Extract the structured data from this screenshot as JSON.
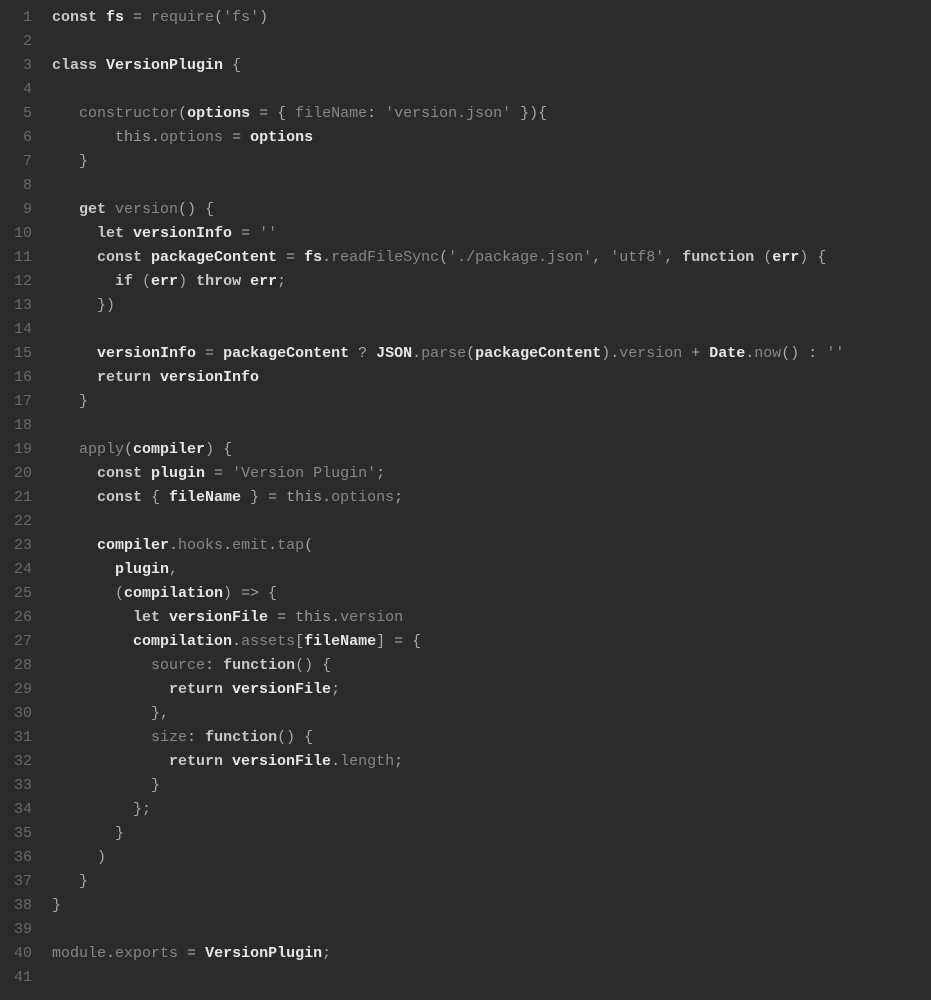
{
  "editor": {
    "language": "javascript",
    "line_count": 41,
    "line_numbers": [
      "1",
      "2",
      "3",
      "4",
      "5",
      "6",
      "7",
      "8",
      "9",
      "10",
      "11",
      "12",
      "13",
      "14",
      "15",
      "16",
      "17",
      "18",
      "19",
      "20",
      "21",
      "22",
      "23",
      "24",
      "25",
      "26",
      "27",
      "28",
      "29",
      "30",
      "31",
      "32",
      "33",
      "34",
      "35",
      "36",
      "37",
      "38",
      "39",
      "40",
      "41"
    ],
    "lines": [
      {
        "n": 1,
        "raw": "const fs = require('fs')",
        "tokens": [
          {
            "t": "const ",
            "c": "kw"
          },
          {
            "t": "fs ",
            "c": "name"
          },
          {
            "t": "= ",
            "c": "pun"
          },
          {
            "t": "require",
            "c": "dim"
          },
          {
            "t": "(",
            "c": "pun"
          },
          {
            "t": "'fs'",
            "c": "str"
          },
          {
            "t": ")",
            "c": "pun"
          }
        ]
      },
      {
        "n": 2,
        "raw": "",
        "tokens": []
      },
      {
        "n": 3,
        "raw": "class VersionPlugin {",
        "tokens": [
          {
            "t": "class ",
            "c": "kw"
          },
          {
            "t": "VersionPlugin ",
            "c": "name"
          },
          {
            "t": "{",
            "c": "pun"
          }
        ]
      },
      {
        "n": 4,
        "raw": "",
        "tokens": []
      },
      {
        "n": 5,
        "raw": "   constructor(options = { fileName: 'version.json' }){",
        "tokens": [
          {
            "t": "   ",
            "c": ""
          },
          {
            "t": "constructor",
            "c": "dim"
          },
          {
            "t": "(",
            "c": "pun"
          },
          {
            "t": "options ",
            "c": "name"
          },
          {
            "t": "= { ",
            "c": "pun"
          },
          {
            "t": "fileName",
            "c": "dim"
          },
          {
            "t": ": ",
            "c": "pun"
          },
          {
            "t": "'version.json'",
            "c": "str"
          },
          {
            "t": " }){",
            "c": "pun"
          }
        ]
      },
      {
        "n": 6,
        "raw": "       this.options = options",
        "tokens": [
          {
            "t": "       ",
            "c": ""
          },
          {
            "t": "this",
            "c": "this"
          },
          {
            "t": ".",
            "c": "pun"
          },
          {
            "t": "options ",
            "c": "dim"
          },
          {
            "t": "= ",
            "c": "pun"
          },
          {
            "t": "options",
            "c": "name"
          }
        ]
      },
      {
        "n": 7,
        "raw": "   }",
        "tokens": [
          {
            "t": "   }",
            "c": "pun"
          }
        ]
      },
      {
        "n": 8,
        "raw": "",
        "tokens": []
      },
      {
        "n": 9,
        "raw": "   get version() {",
        "tokens": [
          {
            "t": "   ",
            "c": ""
          },
          {
            "t": "get ",
            "c": "kw"
          },
          {
            "t": "version",
            "c": "dim"
          },
          {
            "t": "() {",
            "c": "pun"
          }
        ]
      },
      {
        "n": 10,
        "raw": "     let versionInfo = ''",
        "tokens": [
          {
            "t": "     ",
            "c": ""
          },
          {
            "t": "let ",
            "c": "kw"
          },
          {
            "t": "versionInfo ",
            "c": "name"
          },
          {
            "t": "= ",
            "c": "pun"
          },
          {
            "t": "''",
            "c": "str"
          }
        ]
      },
      {
        "n": 11,
        "raw": "     const packageContent = fs.readFileSync('./package.json', 'utf8', function (err) {",
        "tokens": [
          {
            "t": "     ",
            "c": ""
          },
          {
            "t": "const ",
            "c": "kw"
          },
          {
            "t": "packageContent ",
            "c": "name"
          },
          {
            "t": "= ",
            "c": "pun"
          },
          {
            "t": "fs",
            "c": "name"
          },
          {
            "t": ".",
            "c": "pun"
          },
          {
            "t": "readFileSync",
            "c": "dim"
          },
          {
            "t": "(",
            "c": "pun"
          },
          {
            "t": "'./package.json'",
            "c": "str"
          },
          {
            "t": ", ",
            "c": "pun"
          },
          {
            "t": "'utf8'",
            "c": "str"
          },
          {
            "t": ", ",
            "c": "pun"
          },
          {
            "t": "function ",
            "c": "kw"
          },
          {
            "t": "(",
            "c": "pun"
          },
          {
            "t": "err",
            "c": "name"
          },
          {
            "t": ") {",
            "c": "pun"
          }
        ]
      },
      {
        "n": 12,
        "raw": "       if (err) throw err;",
        "tokens": [
          {
            "t": "       ",
            "c": ""
          },
          {
            "t": "if ",
            "c": "kw"
          },
          {
            "t": "(",
            "c": "pun"
          },
          {
            "t": "err",
            "c": "name"
          },
          {
            "t": ") ",
            "c": "pun"
          },
          {
            "t": "throw ",
            "c": "kw"
          },
          {
            "t": "err",
            "c": "name"
          },
          {
            "t": ";",
            "c": "pun"
          }
        ]
      },
      {
        "n": 13,
        "raw": "     })",
        "tokens": [
          {
            "t": "     })",
            "c": "pun"
          }
        ]
      },
      {
        "n": 14,
        "raw": "",
        "tokens": []
      },
      {
        "n": 15,
        "raw": "     versionInfo = packageContent ? JSON.parse(packageContent).version + Date.now() : ''",
        "tokens": [
          {
            "t": "     ",
            "c": ""
          },
          {
            "t": "versionInfo ",
            "c": "name"
          },
          {
            "t": "= ",
            "c": "pun"
          },
          {
            "t": "packageContent ",
            "c": "name"
          },
          {
            "t": "? ",
            "c": "pun"
          },
          {
            "t": "JSON",
            "c": "name"
          },
          {
            "t": ".",
            "c": "pun"
          },
          {
            "t": "parse",
            "c": "dim"
          },
          {
            "t": "(",
            "c": "pun"
          },
          {
            "t": "packageContent",
            "c": "name"
          },
          {
            "t": ").",
            "c": "pun"
          },
          {
            "t": "version ",
            "c": "dim"
          },
          {
            "t": "+ ",
            "c": "pun"
          },
          {
            "t": "Date",
            "c": "name"
          },
          {
            "t": ".",
            "c": "pun"
          },
          {
            "t": "now",
            "c": "dim"
          },
          {
            "t": "() : ",
            "c": "pun"
          },
          {
            "t": "''",
            "c": "str"
          }
        ]
      },
      {
        "n": 16,
        "raw": "     return versionInfo",
        "tokens": [
          {
            "t": "     ",
            "c": ""
          },
          {
            "t": "return ",
            "c": "kw"
          },
          {
            "t": "versionInfo",
            "c": "name"
          }
        ]
      },
      {
        "n": 17,
        "raw": "   }",
        "tokens": [
          {
            "t": "   }",
            "c": "pun"
          }
        ]
      },
      {
        "n": 18,
        "raw": "",
        "tokens": []
      },
      {
        "n": 19,
        "raw": "   apply(compiler) {",
        "tokens": [
          {
            "t": "   ",
            "c": ""
          },
          {
            "t": "apply",
            "c": "dim"
          },
          {
            "t": "(",
            "c": "pun"
          },
          {
            "t": "compiler",
            "c": "name"
          },
          {
            "t": ") {",
            "c": "pun"
          }
        ]
      },
      {
        "n": 20,
        "raw": "     const plugin = 'Version Plugin';",
        "tokens": [
          {
            "t": "     ",
            "c": ""
          },
          {
            "t": "const ",
            "c": "kw"
          },
          {
            "t": "plugin ",
            "c": "name"
          },
          {
            "t": "= ",
            "c": "pun"
          },
          {
            "t": "'Version Plugin'",
            "c": "str"
          },
          {
            "t": ";",
            "c": "pun"
          }
        ]
      },
      {
        "n": 21,
        "raw": "     const { fileName } = this.options;",
        "tokens": [
          {
            "t": "     ",
            "c": ""
          },
          {
            "t": "const ",
            "c": "kw"
          },
          {
            "t": "{ ",
            "c": "pun"
          },
          {
            "t": "fileName ",
            "c": "name"
          },
          {
            "t": "} = ",
            "c": "pun"
          },
          {
            "t": "this",
            "c": "this"
          },
          {
            "t": ".",
            "c": "pun"
          },
          {
            "t": "options",
            "c": "dim"
          },
          {
            "t": ";",
            "c": "pun"
          }
        ]
      },
      {
        "n": 22,
        "raw": "",
        "tokens": []
      },
      {
        "n": 23,
        "raw": "     compiler.hooks.emit.tap(",
        "tokens": [
          {
            "t": "     ",
            "c": ""
          },
          {
            "t": "compiler",
            "c": "name"
          },
          {
            "t": ".",
            "c": "pun"
          },
          {
            "t": "hooks",
            "c": "dim"
          },
          {
            "t": ".",
            "c": "pun"
          },
          {
            "t": "emit",
            "c": "dim"
          },
          {
            "t": ".",
            "c": "pun"
          },
          {
            "t": "tap",
            "c": "dim"
          },
          {
            "t": "(",
            "c": "pun"
          }
        ]
      },
      {
        "n": 24,
        "raw": "       plugin,",
        "tokens": [
          {
            "t": "       ",
            "c": ""
          },
          {
            "t": "plugin",
            "c": "name"
          },
          {
            "t": ",",
            "c": "pun"
          }
        ]
      },
      {
        "n": 25,
        "raw": "       (compilation) => {",
        "tokens": [
          {
            "t": "       (",
            "c": "pun"
          },
          {
            "t": "compilation",
            "c": "name"
          },
          {
            "t": ") => {",
            "c": "pun"
          }
        ]
      },
      {
        "n": 26,
        "raw": "         let versionFile = this.version",
        "tokens": [
          {
            "t": "         ",
            "c": ""
          },
          {
            "t": "let ",
            "c": "kw"
          },
          {
            "t": "versionFile ",
            "c": "name"
          },
          {
            "t": "= ",
            "c": "pun"
          },
          {
            "t": "this",
            "c": "this"
          },
          {
            "t": ".",
            "c": "pun"
          },
          {
            "t": "version",
            "c": "dim"
          }
        ]
      },
      {
        "n": 27,
        "raw": "         compilation.assets[fileName] = {",
        "tokens": [
          {
            "t": "         ",
            "c": ""
          },
          {
            "t": "compilation",
            "c": "name"
          },
          {
            "t": ".",
            "c": "pun"
          },
          {
            "t": "assets",
            "c": "dim"
          },
          {
            "t": "[",
            "c": "pun"
          },
          {
            "t": "fileName",
            "c": "name"
          },
          {
            "t": "] = {",
            "c": "pun"
          }
        ]
      },
      {
        "n": 28,
        "raw": "           source: function() {",
        "tokens": [
          {
            "t": "           ",
            "c": ""
          },
          {
            "t": "source",
            "c": "dim"
          },
          {
            "t": ": ",
            "c": "pun"
          },
          {
            "t": "function",
            "c": "kw"
          },
          {
            "t": "() {",
            "c": "pun"
          }
        ]
      },
      {
        "n": 29,
        "raw": "             return versionFile;",
        "tokens": [
          {
            "t": "             ",
            "c": ""
          },
          {
            "t": "return ",
            "c": "kw"
          },
          {
            "t": "versionFile",
            "c": "name"
          },
          {
            "t": ";",
            "c": "pun"
          }
        ]
      },
      {
        "n": 30,
        "raw": "           },",
        "tokens": [
          {
            "t": "           },",
            "c": "pun"
          }
        ]
      },
      {
        "n": 31,
        "raw": "           size: function() {",
        "tokens": [
          {
            "t": "           ",
            "c": ""
          },
          {
            "t": "size",
            "c": "dim"
          },
          {
            "t": ": ",
            "c": "pun"
          },
          {
            "t": "function",
            "c": "kw"
          },
          {
            "t": "() {",
            "c": "pun"
          }
        ]
      },
      {
        "n": 32,
        "raw": "             return versionFile.length;",
        "tokens": [
          {
            "t": "             ",
            "c": ""
          },
          {
            "t": "return ",
            "c": "kw"
          },
          {
            "t": "versionFile",
            "c": "name"
          },
          {
            "t": ".",
            "c": "pun"
          },
          {
            "t": "length",
            "c": "dim"
          },
          {
            "t": ";",
            "c": "pun"
          }
        ]
      },
      {
        "n": 33,
        "raw": "           }",
        "tokens": [
          {
            "t": "           }",
            "c": "pun"
          }
        ]
      },
      {
        "n": 34,
        "raw": "         };",
        "tokens": [
          {
            "t": "         };",
            "c": "pun"
          }
        ]
      },
      {
        "n": 35,
        "raw": "       }",
        "tokens": [
          {
            "t": "       }",
            "c": "pun"
          }
        ]
      },
      {
        "n": 36,
        "raw": "     )",
        "tokens": [
          {
            "t": "     )",
            "c": "pun"
          }
        ]
      },
      {
        "n": 37,
        "raw": "   }",
        "tokens": [
          {
            "t": "   }",
            "c": "pun"
          }
        ]
      },
      {
        "n": 38,
        "raw": "}",
        "tokens": [
          {
            "t": "}",
            "c": "pun"
          }
        ]
      },
      {
        "n": 39,
        "raw": "",
        "tokens": []
      },
      {
        "n": 40,
        "raw": "module.exports = VersionPlugin;",
        "tokens": [
          {
            "t": "module",
            "c": "dim"
          },
          {
            "t": ".",
            "c": "pun"
          },
          {
            "t": "exports ",
            "c": "dim"
          },
          {
            "t": "= ",
            "c": "pun"
          },
          {
            "t": "VersionPlugin",
            "c": "name"
          },
          {
            "t": ";",
            "c": "pun"
          }
        ]
      },
      {
        "n": 41,
        "raw": "",
        "tokens": []
      }
    ]
  }
}
